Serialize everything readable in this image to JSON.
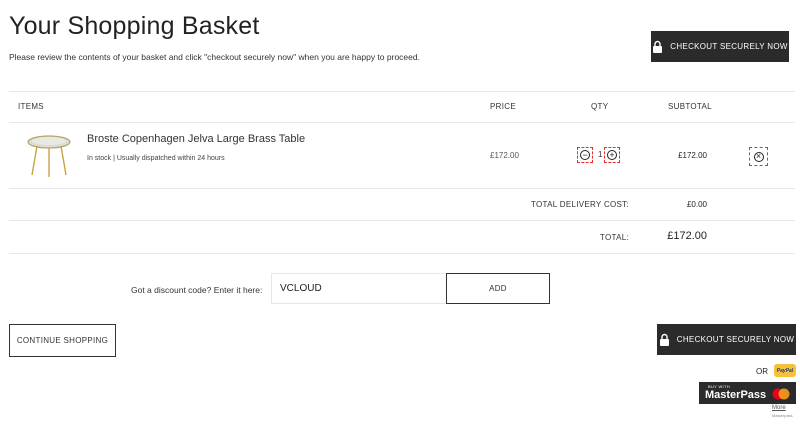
{
  "header": {
    "title": "Your Shopping Basket",
    "intro": "Please review the contents of your basket and click \"checkout securely now\" when you are happy to proceed.",
    "checkout_label": "CHECKOUT SECURELY NOW"
  },
  "table": {
    "columns": {
      "items": "ITEMS",
      "price": "PRICE",
      "qty": "QTY",
      "subtotal": "SUBTOTAL"
    },
    "items": [
      {
        "name": "Broste Copenhagen Jelva Large Brass Table",
        "stock": "In stock | Usually dispatched within 24 hours",
        "price": "£172.00",
        "qty": "1",
        "subtotal": "£172.00"
      }
    ]
  },
  "totals": {
    "delivery_label": "TOTAL DELIVERY COST:",
    "delivery_value": "£0.00",
    "total_label": "TOTAL:",
    "total_value": "£172.00"
  },
  "discount": {
    "label": "Got a discount code? Enter it here:",
    "value": "VCLOUD",
    "add_label": "ADD"
  },
  "footer": {
    "continue_label": "CONTINUE SHOPPING",
    "checkout_label": "CHECKOUT SECURELY NOW",
    "or_label": "OR",
    "paypal_label": "PayPal",
    "masterpass_top": "BUY WITH",
    "masterpass_label": "MasterPass",
    "masterpass_link": "More",
    "masterpass_link_sub": "Masterpass"
  },
  "icons": {
    "lock": "lock-icon",
    "minus": "minus-circle-icon",
    "plus": "plus-circle-icon",
    "remove": "remove-circle-icon"
  },
  "colors": {
    "button_dark": "#2b2b2b",
    "dashed_outline": "#dd3333",
    "paypal_yellow": "#f7c23a"
  }
}
